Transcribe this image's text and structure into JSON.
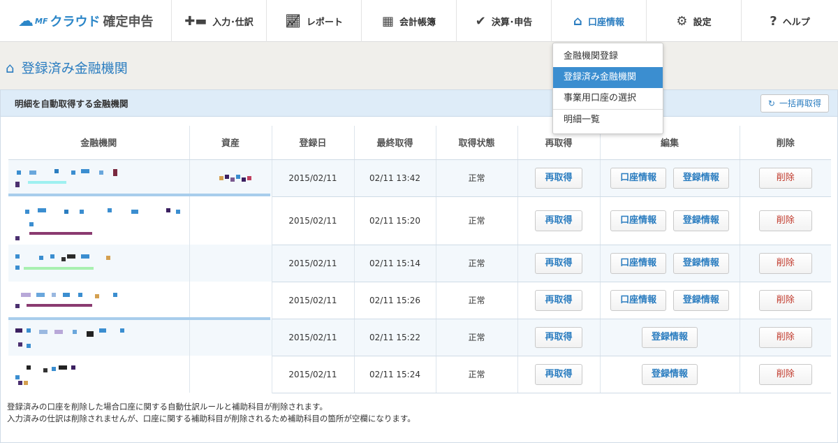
{
  "app": {
    "logo_mf": "MF",
    "logo_text_a": "クラウド",
    "logo_text_b": "確定申告"
  },
  "nav": {
    "items": [
      {
        "label": "入力･仕訳",
        "icon": "plus-ledger-icon"
      },
      {
        "label": "レポート",
        "icon": "chart-line-icon"
      },
      {
        "label": "会計帳簿",
        "icon": "grid-icon"
      },
      {
        "label": "決算･申告",
        "icon": "check-icon"
      },
      {
        "label": "口座情報",
        "icon": "home-icon"
      },
      {
        "label": "設定",
        "icon": "gear-icon"
      },
      {
        "label": "ヘルプ",
        "icon": "question-icon"
      }
    ]
  },
  "dropdown": {
    "items": [
      "金融機関登録",
      "登録済み金融機関",
      "事業用口座の選択",
      "明細一覧"
    ]
  },
  "page": {
    "title": "登録済み金融機関"
  },
  "panel": {
    "heading": "明細を自動取得する金融機関",
    "refetch_all_label": "一括再取得"
  },
  "table": {
    "headers": [
      "金融機関",
      "資産",
      "登録日",
      "最終取得",
      "取得状態",
      "再取得",
      "編集",
      "削除"
    ],
    "rows": [
      {
        "registered": "2015/02/11",
        "last": "02/11 13:42",
        "status": "正常",
        "refetch": "再取得",
        "edit1": "口座情報",
        "edit2": "登録情報",
        "delete": "削除"
      },
      {
        "registered": "2015/02/11",
        "last": "02/11 15:20",
        "status": "正常",
        "refetch": "再取得",
        "edit1": "口座情報",
        "edit2": "登録情報",
        "delete": "削除"
      },
      {
        "registered": "2015/02/11",
        "last": "02/11 15:14",
        "status": "正常",
        "refetch": "再取得",
        "edit1": "口座情報",
        "edit2": "登録情報",
        "delete": "削除"
      },
      {
        "registered": "2015/02/11",
        "last": "02/11 15:26",
        "status": "正常",
        "refetch": "再取得",
        "edit1": "口座情報",
        "edit2": "登録情報",
        "delete": "削除"
      },
      {
        "registered": "2015/02/11",
        "last": "02/11 15:22",
        "status": "正常",
        "refetch": "再取得",
        "edit2": "登録情報",
        "delete": "削除"
      },
      {
        "registered": "2015/02/11",
        "last": "02/11 15:24",
        "status": "正常",
        "refetch": "再取得",
        "edit2": "登録情報",
        "delete": "削除"
      }
    ]
  },
  "footnote": {
    "line1": "登録済みの口座を削除した場合口座に関する自動仕訳ルールと補助科目が削除されます。",
    "line2": "入力済みの仕訳は削除されませんが、口座に関する補助科目が削除されるため補助科目の箇所が空欄になります。"
  },
  "colors": {
    "accent": "#2b7dc0",
    "selected": "#3b8ed0",
    "danger": "#c0392b",
    "panel_head": "#deecf8"
  }
}
